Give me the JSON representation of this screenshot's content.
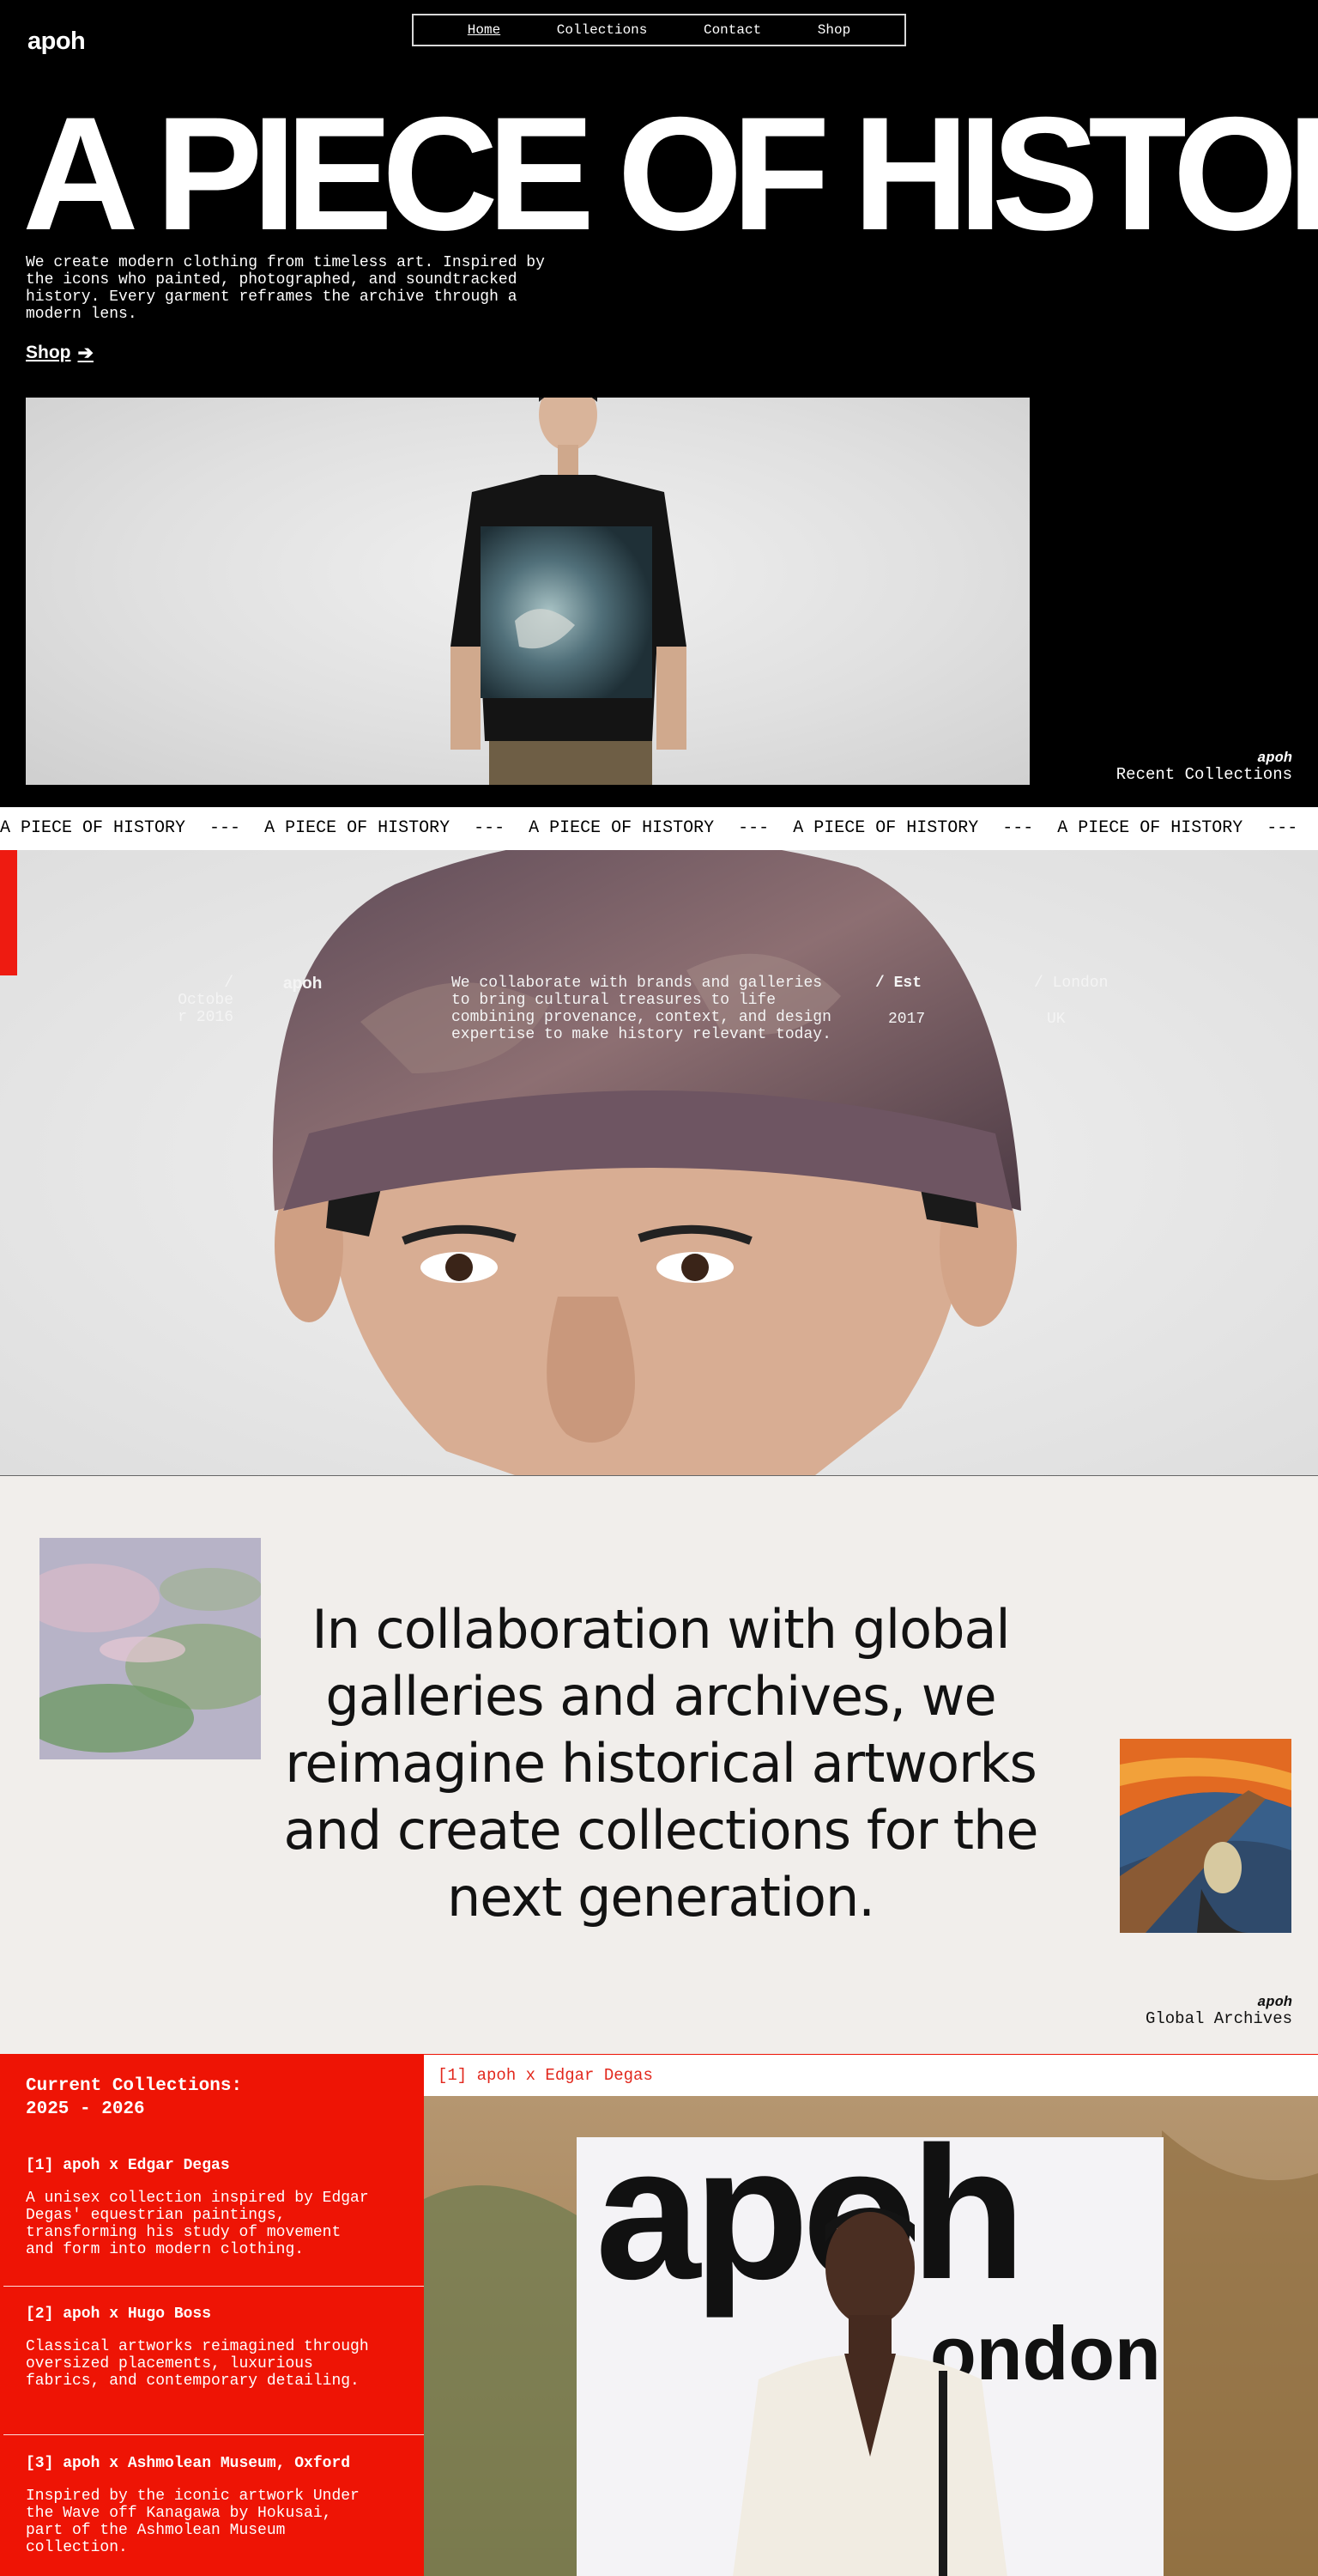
{
  "brand": {
    "logo": "apoh"
  },
  "nav": [
    {
      "label": "Home"
    },
    {
      "label": "Collections"
    },
    {
      "label": "Contact"
    },
    {
      "label": "Shop"
    }
  ],
  "hero": {
    "headline": "A PIECE OF HISTORY",
    "description": "We create modern clothing from timeless art. Inspired by the icons who painted, photographed, and soundtracked history. Every garment reframes the archive through a modern lens.",
    "shop_label": "Shop",
    "caption_brand": "apoh",
    "caption_text": "Recent Collections"
  },
  "marquee": {
    "text": "A PIECE OF HISTORY",
    "separator": "---"
  },
  "about": {
    "founded_label": "/ Octobe r 2016",
    "brand": "apoh",
    "text": "We collaborate with brands and galleries to bring cultural treasures to life combining provenance, context, and design expertise to make history relevant today.",
    "est_label": "/ Est",
    "est_year": "2017",
    "city_label": "/ London",
    "country": "UK"
  },
  "collab": {
    "text": "In collaboration with global galleries and archives, we reimagine historical artworks and create collections for the next generation.",
    "caption_brand": "apoh",
    "caption_text": "Global Archives"
  },
  "collections": {
    "title": "Current Collections: 2025 - 2026",
    "items": [
      {
        "title": "[1] apoh x Edgar Degas",
        "desc": "A unisex collection inspired by Edgar Degas' equestrian paintings, transforming his study of movement and form into modern clothing."
      },
      {
        "title": "[2] apoh x Hugo Boss",
        "desc": "Classical artworks reimagined through oversized placements, luxurious fabrics, and contemporary detailing."
      },
      {
        "title": "[3] apoh x Ashmolean Museum, Oxford",
        "desc": "Inspired by the iconic artwork Under the Wave off Kanagawa by Hokusai, part of the Ashmolean Museum collection."
      }
    ],
    "active_label": "[1] apoh x Edgar Degas",
    "poster_word": "apoh",
    "poster_sub": "ondon"
  },
  "colors": {
    "accent_red": "#ee1405",
    "dark": "#000000",
    "cream": "#f1eeeb"
  }
}
